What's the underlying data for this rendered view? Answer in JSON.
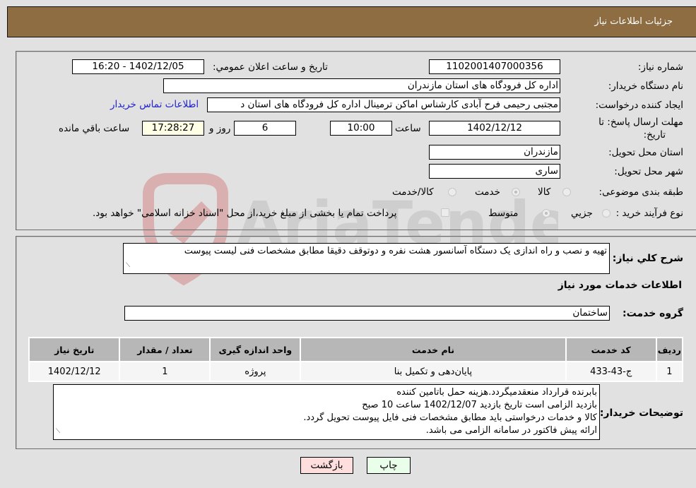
{
  "header": {
    "title": "جزئيات اطلاعات نیاز"
  },
  "fields": {
    "need_number": {
      "label": "شماره نیاز:",
      "value": "1102001407000356"
    },
    "announce_datetime": {
      "label": "تاریخ و ساعت اعلان عمومي:",
      "value": "1402/12/05 - 16:20"
    },
    "buyer_org": {
      "label": "نام دستگاه خریدار:",
      "value": "اداره کل فرودگاه های استان مازندران"
    },
    "requester": {
      "label": "ایجاد کننده درخواست:",
      "value": "مجتبی رحیمی فرح آبادی کارشناس اماکن ترمینال اداره کل فرودگاه های استان د"
    },
    "buyer_contact_link": "اطلاعات تماس خریدار",
    "deadline": {
      "label_line1": "مهلت ارسال پاسخ: تا",
      "label_line2": "تاریخ:",
      "date": "1402/12/12",
      "time_label": "ساعت",
      "time": "10:00",
      "days": "6",
      "days_label": "روز و",
      "remaining": "17:28:27",
      "remaining_label": "ساعت باقي مانده"
    },
    "delivery_province": {
      "label": "استان محل تحویل:",
      "value": "مازندران"
    },
    "delivery_city": {
      "label": "شهر محل تحویل:",
      "value": "ساری"
    },
    "category": {
      "label": "طبقه بندی موضوعی:",
      "options": [
        "کالا",
        "خدمت",
        "کالا/خدمت"
      ],
      "selected": "خدمت"
    },
    "purchase_process": {
      "label": "نوع فرآیند خرید :",
      "options": [
        "جزيي",
        "متوسط"
      ],
      "selected": "متوسط",
      "treasury_checkbox_label": "پرداخت تمام یا بخشی از مبلغ خرید،از محل \"اسناد خزانه اسلامی\" خواهد بود.",
      "treasury_checked": false
    }
  },
  "description": {
    "label": "شرح کلي نیاز:",
    "value": "تهیه و نصب و راه اندازی یک دستگاه آسانسور هشت نفره و دوتوقف دقیقا مطابق مشخصات فنی لیست پیوست"
  },
  "services_section": {
    "title": "اطلاعات خدمات مورد نیاز",
    "group_label": "گروه خدمت:",
    "group_value": "ساختمان",
    "table": {
      "headers": [
        "ردیف",
        "کد خدمت",
        "نام خدمت",
        "واحد اندازه گیری",
        "تعداد / مقدار",
        "تاریخ نیاز"
      ],
      "rows": [
        [
          "1",
          "ج-43-433",
          "پایان‌دهی و تکمیل بنا",
          "پروژه",
          "1",
          "1402/12/12"
        ]
      ]
    }
  },
  "buyer_notes": {
    "label": "توضیحات خریدار:",
    "lines": [
      "بابرنده قرارداد منعقدمیگردد.هزینه حمل باتامین کننده",
      "بازدید الزامی است تاریخ بازدید 1402/12/07 ساعت 10 صبح",
      "کالا و خدمات درخواستی باید مطابق مشخصات فنی فایل پیوست تحویل گردد.",
      "ارائه پیش فاکتور در سامانه الزامی می باشد."
    ]
  },
  "buttons": {
    "print": "چاپ",
    "back": "بازگشت"
  },
  "watermark": {
    "text": "AriaTender.net"
  },
  "colors": {
    "header_bg": "#8d6d41",
    "link": "#2222cc",
    "print_bg": "#eaffea",
    "back_bg": "#ffdede",
    "remaining_bg": "#ffffe6"
  }
}
